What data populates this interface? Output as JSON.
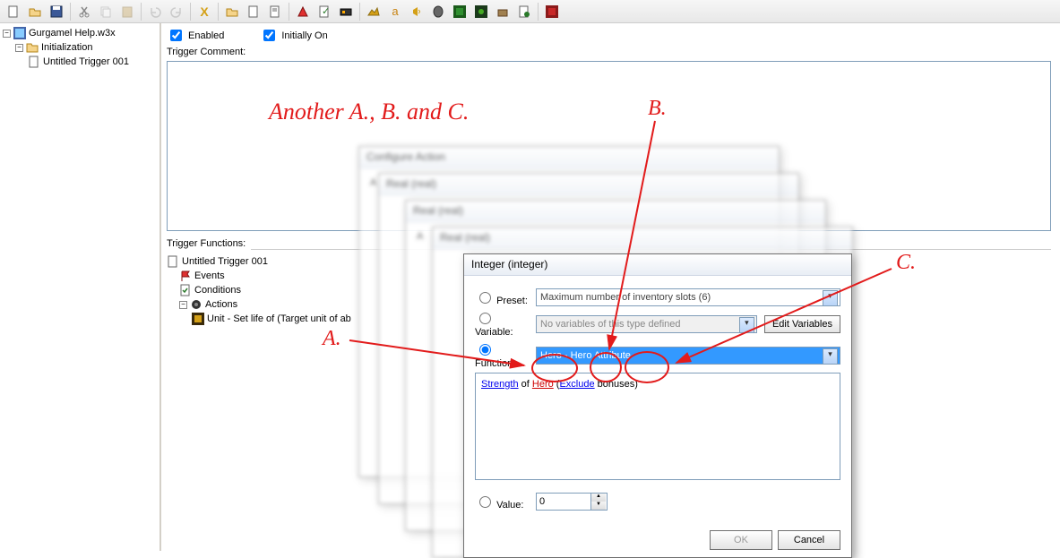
{
  "tree": {
    "root": "Gurgamel Help.w3x",
    "folder": "Initialization",
    "trigger": "Untitled Trigger 001"
  },
  "checks": {
    "enabled": "Enabled",
    "initially": "Initially On"
  },
  "labels": {
    "trigger_comment": "Trigger Comment:",
    "trigger_functions": "Trigger Functions:"
  },
  "tf": {
    "title": "Untitled Trigger 001",
    "events": "Events",
    "conditions": "Conditions",
    "actions": "Actions",
    "action1": "Unit - Set life of (Target unit of ab"
  },
  "dlg0": {
    "title": "Configure Action"
  },
  "dlg1": {
    "title": "Real (real)"
  },
  "dlg2": {
    "title": "Real (real)"
  },
  "dlg3": {
    "title": "Real (real)"
  },
  "dlg4": {
    "title": "Integer (integer)",
    "preset_lbl": "Preset:",
    "preset_val": "Maximum number of inventory slots (6)",
    "variable_lbl": "Variable:",
    "variable_val": "No variables of this type defined",
    "edit_vars": "Edit Variables",
    "function_lbl": "Function:",
    "function_val": "Hero - Hero Attribute",
    "func_p1": "Strength",
    "func_of": " of ",
    "func_p2": "Hero",
    "func_open": " (",
    "func_p3": "Exclude",
    "func_close": " bonuses)",
    "value_lbl": "Value:",
    "value_val": "0",
    "ok": "OK",
    "cancel": "Cancel"
  },
  "anno": {
    "title": "Another A., B. and C.",
    "a": "A.",
    "b": "B.",
    "c": "C."
  }
}
